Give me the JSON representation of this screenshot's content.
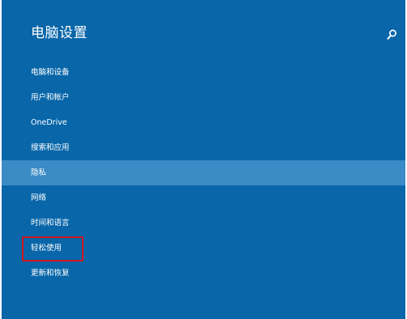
{
  "header": {
    "title": "电脑设置",
    "search_icon": "search-icon"
  },
  "nav": {
    "items": [
      {
        "label": "电脑和设备"
      },
      {
        "label": "用户和帐户"
      },
      {
        "label": "OneDrive"
      },
      {
        "label": "搜索和应用"
      },
      {
        "label": "隐私"
      },
      {
        "label": "网络"
      },
      {
        "label": "时间和语言"
      },
      {
        "label": "轻松使用"
      },
      {
        "label": "更新和恢复"
      }
    ],
    "selected_index": 4,
    "annotated_index": 7
  },
  "colors": {
    "background": "#0866a9",
    "selected": "#3a8bc6",
    "annotation": "#d1141b",
    "text": "#ffffff"
  }
}
